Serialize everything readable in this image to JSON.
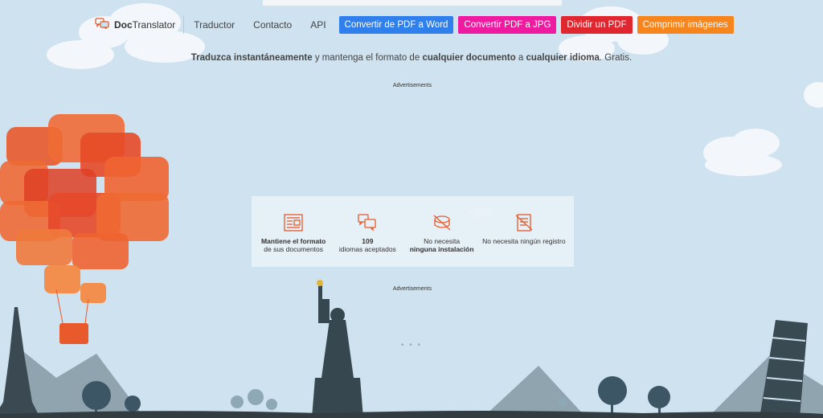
{
  "brand": {
    "bold": "Doc",
    "rest": "Translator"
  },
  "nav": {
    "links": [
      "Traductor",
      "Contacto",
      "API"
    ],
    "buttons": [
      {
        "label": "Convertir de PDF a Word",
        "color": "#2f80ed"
      },
      {
        "label": "Convertir PDF a JPG",
        "color": "#ee1aa0"
      },
      {
        "label": "Dividir un PDF",
        "color": "#e0272f"
      },
      {
        "label": "Comprimir imágenes",
        "color": "#f7851e"
      }
    ]
  },
  "tagline": {
    "p1": "Traduzca instantáneamente",
    "p2": " y mantenga el formato de ",
    "p3": "cualquier documento",
    "p4": " a ",
    "p5": "cualquier idioma",
    "p6": ". Gratis."
  },
  "ads": {
    "top": "Advertisements",
    "bottom": "Advertisements"
  },
  "features": [
    {
      "icon": "document-format-icon",
      "line1": "Mantiene el formato",
      "line2": "de sus documentos"
    },
    {
      "icon": "languages-icon",
      "line1": "109",
      "line2": "idiomas aceptados"
    },
    {
      "icon": "no-install-icon",
      "line1": "No necesita",
      "line2": "ninguna instalación"
    },
    {
      "icon": "no-register-icon",
      "line1": "No necesita ningún registro",
      "line2": ""
    }
  ],
  "loading": "• • •",
  "colors": {
    "accent": "#e8592b",
    "sky": "#cfe2ef",
    "ground": "#333c40"
  }
}
